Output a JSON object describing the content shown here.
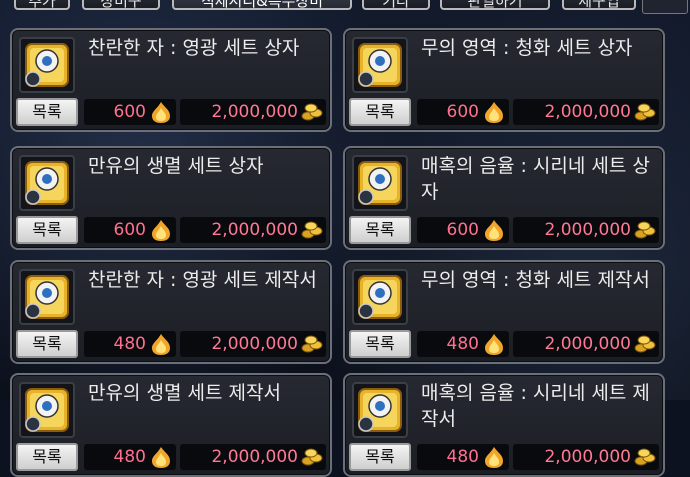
{
  "tabs": [
    {
      "label": "추가"
    },
    {
      "label": "장비구"
    },
    {
      "label": "직제시리&특수장비"
    },
    {
      "label": "기타"
    },
    {
      "label": "판열하기"
    },
    {
      "label": "제구입"
    }
  ],
  "colors": {
    "price_text": "#ff6f8f",
    "card_border": "#6b6f78",
    "button_bg": "#e8e8e8"
  },
  "cards": [
    {
      "title": "찬란한 자 : 영광 세트 상자",
      "button": "목록",
      "points": "600",
      "coins": "2,000,000",
      "icon": "radiance-set-box-icon"
    },
    {
      "title": "무의 영역 : 청화 세트 상자",
      "button": "목록",
      "points": "600",
      "coins": "2,000,000",
      "icon": "void-realm-set-box-icon"
    },
    {
      "title": "만유의 생멸 세트 상자",
      "button": "목록",
      "points": "600",
      "coins": "2,000,000",
      "icon": "all-life-set-box-icon"
    },
    {
      "title": "매혹의 음율 : 시리네 세트 상자",
      "button": "목록",
      "points": "600",
      "coins": "2,000,000",
      "icon": "siren-melody-set-box-icon"
    },
    {
      "title": "찬란한 자 : 영광 세트 제작서",
      "button": "목록",
      "points": "480",
      "coins": "2,000,000",
      "icon": "radiance-recipe-icon"
    },
    {
      "title": "무의 영역 : 청화 세트 제작서",
      "button": "목록",
      "points": "480",
      "coins": "2,000,000",
      "icon": "void-realm-recipe-icon"
    },
    {
      "title": "만유의 생멸 세트 제작서",
      "button": "목록",
      "points": "480",
      "coins": "2,000,000",
      "icon": "all-life-recipe-icon"
    },
    {
      "title": "매혹의 음율 : 시리네 세트 제작서",
      "button": "목록",
      "points": "480",
      "coins": "2,000,000",
      "icon": "siren-melody-recipe-icon"
    }
  ]
}
